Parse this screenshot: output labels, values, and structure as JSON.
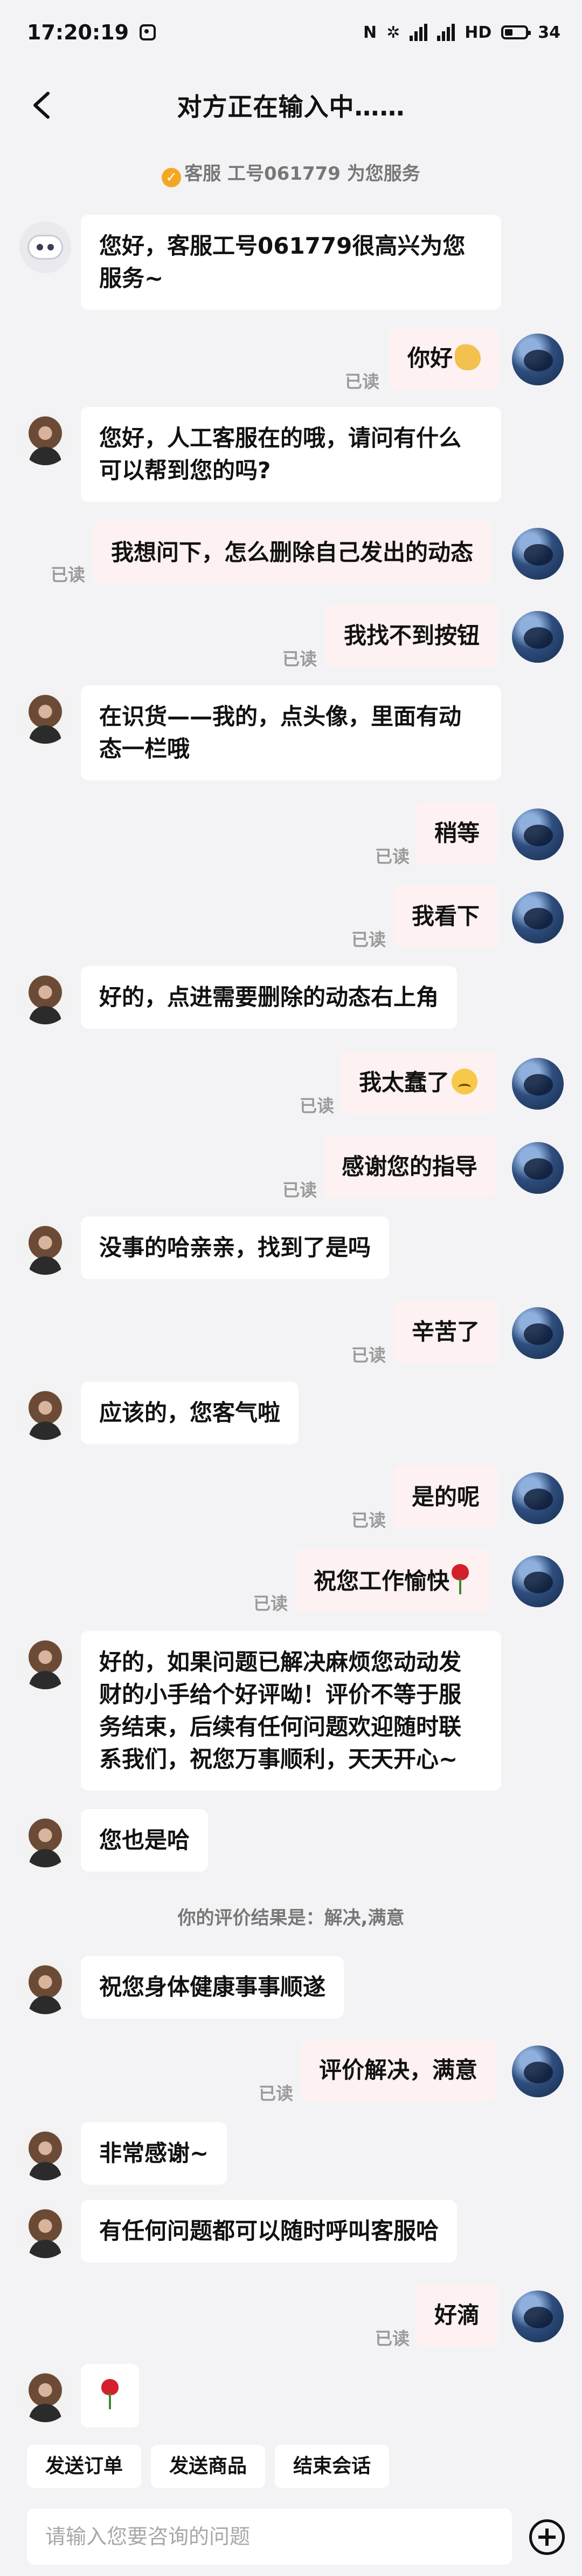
{
  "status_bar": {
    "time": "17:20:19",
    "battery": "34"
  },
  "header": {
    "title": "对方正在输入中……"
  },
  "service_notice": "客服 工号061779 为您服务",
  "messages": [
    {
      "from": "bot",
      "text": "您好，客服工号061779很高兴为您服务~"
    },
    {
      "from": "user",
      "text": "你好",
      "emoji": "hand",
      "status": "已读"
    },
    {
      "from": "agent",
      "text": "您好，人工客服在的哦，请问有什么可以帮到您的吗?"
    },
    {
      "from": "user",
      "text": "我想问下，怎么删除自己发出的动态",
      "status": "已读"
    },
    {
      "from": "user",
      "text": "我找不到按钮",
      "status": "已读"
    },
    {
      "from": "agent",
      "text": "在识货——我的，点头像，里面有动态一栏哦"
    },
    {
      "from": "user",
      "text": "稍等",
      "status": "已读"
    },
    {
      "from": "user",
      "text": "我看下",
      "status": "已读"
    },
    {
      "from": "agent",
      "text": "好的，点进需要删除的动态右上角"
    },
    {
      "from": "user",
      "text": "我太蠢了",
      "emoji": "sad",
      "status": "已读"
    },
    {
      "from": "user",
      "text": "感谢您的指导",
      "status": "已读"
    },
    {
      "from": "agent",
      "text": "没事的哈亲亲，找到了是吗"
    },
    {
      "from": "user",
      "text": "辛苦了",
      "status": "已读"
    },
    {
      "from": "agent",
      "text": "应该的，您客气啦"
    },
    {
      "from": "user",
      "text": "是的呢",
      "status": "已读"
    },
    {
      "from": "user",
      "text": "祝您工作愉快",
      "emoji": "rose",
      "status": "已读"
    },
    {
      "from": "agent",
      "text": "好的，如果问题已解决麻烦您动动发财的小手给个好评呦！评价不等于服务结束，后续有任何问题欢迎随时联系我们，祝您万事顺利，天天开心~"
    },
    {
      "from": "agent",
      "text": "您也是哈"
    },
    {
      "from": "system",
      "text": "你的评价结果是：解决,满意"
    },
    {
      "from": "agent",
      "text": "祝您身体健康事事顺遂"
    },
    {
      "from": "user",
      "text": "评价解决，满意",
      "status": "已读"
    },
    {
      "from": "agent",
      "text": "非常感谢~"
    },
    {
      "from": "agent",
      "text": "有任何问题都可以随时呼叫客服哈"
    },
    {
      "from": "user",
      "text": "好滴",
      "status": "已读"
    },
    {
      "from": "agent",
      "text": "",
      "emoji": "rose"
    }
  ],
  "footer": {
    "quick_actions": [
      "发送订单",
      "发送商品",
      "结束会话"
    ],
    "input_placeholder": "请输入您要咨询的问题"
  }
}
